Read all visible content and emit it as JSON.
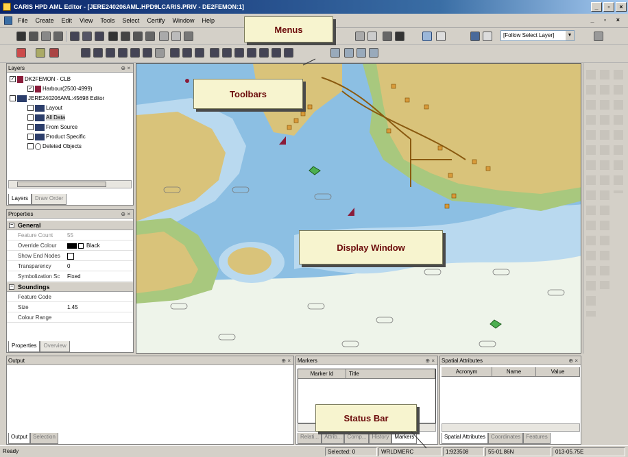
{
  "window": {
    "title": "CARIS HPD AML Editor - [JERE240206AML.HPD9LCARIS.PRIV - DE2FEMON:1]"
  },
  "menus": [
    "File",
    "Create",
    "Edit",
    "View",
    "Tools",
    "Select",
    "Certify",
    "Window",
    "Help"
  ],
  "toolbar": {
    "follow_select": "[Follow Select Layer]"
  },
  "layers_panel": {
    "title": "Layers",
    "items": [
      "DK2FEMON - CLB",
      "Harbour(2500-4999)",
      "JERE240206AML:45698 Editor",
      "Layout",
      "All Data",
      "From Source",
      "Product Specific",
      "Deleted Objects"
    ],
    "tabs": [
      "Layers",
      "Draw Order"
    ]
  },
  "properties_panel": {
    "title": "Properties",
    "sections": [
      {
        "name": "General",
        "rows": [
          {
            "key": "Feature Count",
            "value": "55"
          },
          {
            "key": "Override Colour",
            "value": "Black"
          },
          {
            "key": "Show End Nodes",
            "value": ""
          },
          {
            "key": "Transparency",
            "value": "0"
          },
          {
            "key": "Symbolization Sc",
            "value": "Fixed"
          }
        ]
      },
      {
        "name": "Soundings",
        "rows": [
          {
            "key": "Feature Code",
            "value": ""
          },
          {
            "key": "Size",
            "value": "1.45"
          },
          {
            "key": "Colour Range",
            "value": ""
          }
        ]
      }
    ],
    "tabs": [
      "Properties",
      "Overview"
    ]
  },
  "output_panel": {
    "title": "Output",
    "tabs": [
      "Output",
      "Selection"
    ]
  },
  "markers_panel": {
    "title": "Markers",
    "columns": [
      "Marker Id",
      "Title"
    ],
    "tabs": [
      "Relati...",
      "Attrib...",
      "Comp...",
      "History",
      "Markers"
    ]
  },
  "spatial_panel": {
    "title": "Spatial Attributes",
    "columns": [
      "Acronym",
      "Name",
      "Value"
    ],
    "tabs": [
      "Spatial Attributes",
      "Coordinates",
      "Features"
    ]
  },
  "callouts": {
    "menus": "Menus",
    "toolbars": "Toolbars",
    "display": "Display Window",
    "status": "Status Bar"
  },
  "status": {
    "ready": "Ready",
    "selected": "Selected: 0",
    "projection": "WRLDMERC",
    "scale": "1:923508",
    "lat": "55-01.86N",
    "lon": "013-05.75E"
  },
  "colors": {
    "land": "#d9c37a",
    "shallow": "#8cbfe3",
    "medium": "#b9d9ef",
    "deep": "#eef4ea",
    "intertidal": "#a8c87e",
    "callout_text": "#6b0a0a"
  }
}
